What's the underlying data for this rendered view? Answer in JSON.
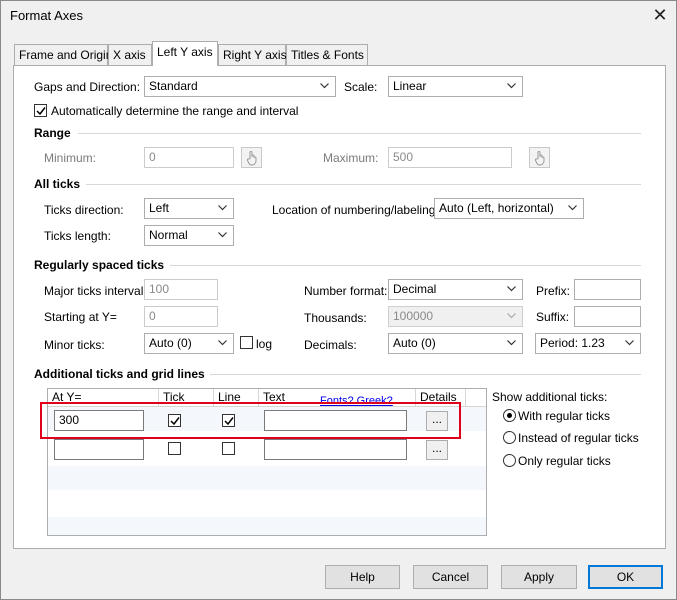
{
  "window": {
    "title": "Format Axes",
    "close_glyph": "✕"
  },
  "tabs": [
    "Frame and Origin",
    "X axis",
    "Left Y axis",
    "Right Y axis",
    "Titles & Fonts"
  ],
  "active_tab": "Left Y axis",
  "top": {
    "gaps_label": "Gaps and Direction:",
    "gaps_value": "Standard",
    "scale_label": "Scale:",
    "scale_value": "Linear",
    "auto_range_label": "Automatically determine the range and interval",
    "auto_range_checked": true
  },
  "range": {
    "heading": "Range",
    "min_label": "Minimum:",
    "min_value": "0",
    "max_label": "Maximum:",
    "max_value": "500"
  },
  "all_ticks": {
    "heading": "All ticks",
    "direction_label": "Ticks direction:",
    "direction_value": "Left",
    "location_label": "Location of numbering/labeling:",
    "location_value": "Auto (Left, horizontal)",
    "length_label": "Ticks length:",
    "length_value": "Normal"
  },
  "regular": {
    "heading": "Regularly spaced ticks",
    "major_label": "Major ticks interval:",
    "major_value": "100",
    "start_label": "Starting at Y=",
    "start_value": "0",
    "minor_label": "Minor ticks:",
    "minor_value": "Auto (0)",
    "log_label": "log",
    "number_format_label": "Number format:",
    "number_format_value": "Decimal",
    "thousands_label": "Thousands:",
    "thousands_value": "100000",
    "decimals_label": "Decimals:",
    "decimals_value": "Auto (0)",
    "prefix_label": "Prefix:",
    "prefix_value": "",
    "suffix_label": "Suffix:",
    "suffix_value": "",
    "period_value": "Period: 1.23"
  },
  "additional": {
    "heading": "Additional ticks and grid lines",
    "columns": [
      "At Y=",
      "Tick",
      "Line",
      "Text",
      "Details"
    ],
    "fonts_link": "Fonts? Greek?",
    "rows": [
      {
        "at_y": "300",
        "tick": true,
        "line": true,
        "text": "",
        "details": "..."
      },
      {
        "at_y": "",
        "tick": false,
        "line": false,
        "text": "",
        "details": "..."
      }
    ],
    "show_label": "Show additional ticks:",
    "options": [
      "With regular ticks",
      "Instead of regular ticks",
      "Only regular ticks"
    ],
    "selected_option": "With regular ticks"
  },
  "buttons": {
    "help": "Help",
    "cancel": "Cancel",
    "apply": "Apply",
    "ok": "OK"
  }
}
